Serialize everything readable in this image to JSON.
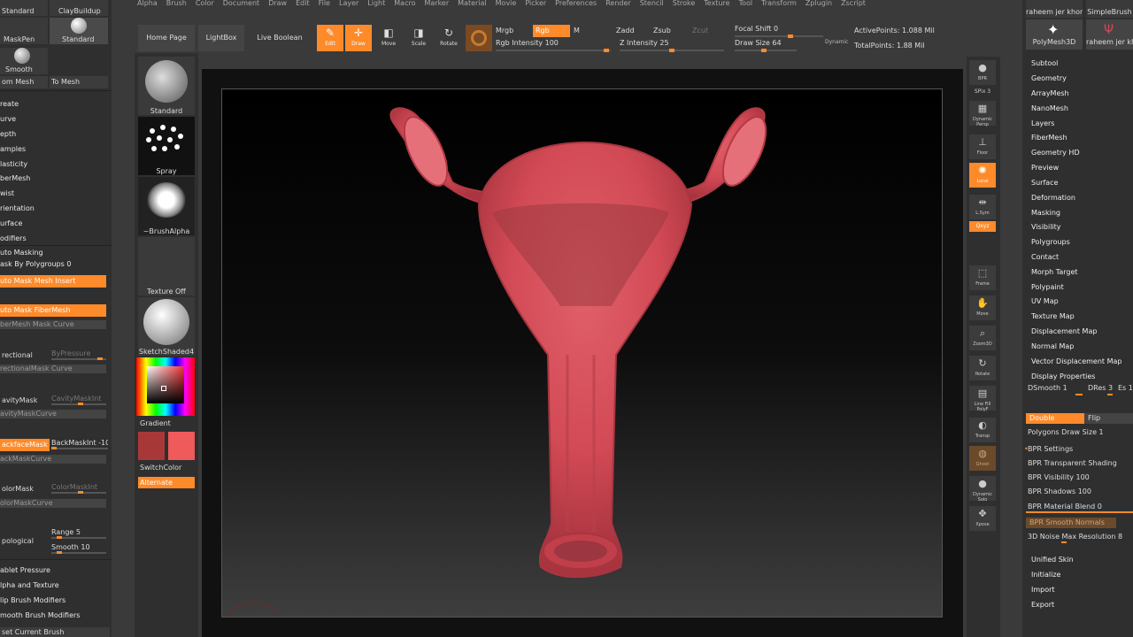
{
  "menu": [
    "Alpha",
    "Brush",
    "Color",
    "Document",
    "Draw",
    "Edit",
    "File",
    "Layer",
    "Light",
    "Macro",
    "Marker",
    "Material",
    "Movie",
    "Picker",
    "Preferences",
    "Render",
    "Stencil",
    "Stroke",
    "Texture",
    "Tool",
    "Transform",
    "Zplugin",
    "Zscript"
  ],
  "left_top": {
    "standard": "Standard",
    "claybuildup": "ClayBuildup",
    "maskpen": "MaskPen",
    "standard2": "Standard",
    "smooth": "Smooth",
    "from_mesh": "om Mesh",
    "to_mesh": "To Mesh"
  },
  "left_menu": [
    "reate",
    "urve",
    "epth",
    "amples",
    "lasticity",
    "berMesh",
    "wist",
    "rientation",
    "urface",
    "odifiers"
  ],
  "auto_masking": {
    "header": "uto Masking",
    "mask_by_polygroups": "ask By Polygroups 0",
    "auto_mask_mesh_insert": "uto Mask Mesh Insert",
    "auto_mask_fibermesh": "uto Mask FiberMesh",
    "fibermesh_mask_curve": "berMesh Mask Curve",
    "directional": "rectional",
    "by_pressure": "ByPressure",
    "directional_mask_curve": "rectionalMask Curve",
    "cavity_mask": "avityMask",
    "cavity_mask_int": "CavityMaskInt",
    "cavity_mask_curve": "avityMaskCurve",
    "backface_mask": "ackfaceMask",
    "backmask_int": "BackMaskInt -10",
    "backmask_curve": "ackMaskCurve",
    "color_mask": "olorMask",
    "color_mask_int": "ColorMaskInt",
    "color_mask_curve": "olorMaskCurve",
    "topological": "pological",
    "range": "Range 5",
    "smooth": "Smooth 10"
  },
  "left_bottom": [
    "ablet Pressure",
    "lpha and Texture",
    "lip Brush Modifiers",
    "mooth Brush Modifiers",
    "set Current Brush"
  ],
  "brushes": {
    "standard": "Standard",
    "spray": "Spray",
    "brush_alpha": "~BrushAlpha",
    "texture_off": "Texture Off",
    "material": "SketchShaded4",
    "gradient": "Gradient",
    "switch_color": "SwitchColor",
    "alternate": "Alternate",
    "color_main": "#a83838",
    "color_secondary": "#ef5a5a"
  },
  "toolbar": {
    "home_page": "Home Page",
    "lightbox": "LightBox",
    "live_boolean": "Live Boolean",
    "edit": "Edit",
    "draw": "Draw",
    "move": "Move",
    "scale": "Scale",
    "rotate": "Rotate",
    "mrgb": "Mrgb",
    "rgb": "Rgb",
    "m": "M",
    "rgb_intensity": "Rgb Intensity 100",
    "zadd": "Zadd",
    "zsub": "Zsub",
    "zcut": "Zcut",
    "z_intensity": "Z Intensity 25",
    "focal_shift": "Focal Shift 0",
    "draw_size": "Draw Size 64",
    "dynamic": "Dynamic",
    "active_points": "ActivePoints: 1.088 Mil",
    "total_points": "TotalPoints: 1.88 Mil"
  },
  "right_shelf": [
    "BPR",
    "SPix 3",
    "Dynamic Persp",
    "Floor",
    "Local",
    "L.Sym",
    "Qxyz",
    "Frame",
    "Move",
    "Zoom3D",
    "Rotate",
    "Line Fill PolyF",
    "Transp",
    "Ghost",
    "Dynamic Solo",
    "Xpose"
  ],
  "tools": {
    "tool1": "raheem jer khord",
    "tool2": "SimpleBrush",
    "tool3": "PolyMesh3D",
    "tool4": "raheem jer khord"
  },
  "subtool_menu": [
    "Subtool",
    "Geometry",
    "ArrayMesh",
    "NanoMesh",
    "Layers",
    "FiberMesh",
    "Geometry HD",
    "Preview",
    "Surface",
    "Deformation",
    "Masking",
    "Visibility",
    "Polygroups",
    "Contact",
    "Morph Target",
    "Polypaint",
    "UV Map",
    "Texture Map",
    "Displacement Map",
    "Normal Map",
    "Vector Displacement Map"
  ],
  "display_properties": {
    "header": "Display Properties",
    "dsmooth": "DSmooth 1",
    "dres": "DRes 3",
    "es": "Es 1",
    "double": "Double",
    "flip": "Flip",
    "polygons_draw_size": "Polygons Draw Size 1"
  },
  "bpr_settings": {
    "header": "BPR Settings",
    "transparent_shading": "BPR Transparent Shading",
    "visibility": "BPR Visibility 100",
    "shadows": "BPR Shadows 100",
    "material_blend": "BPR Material Blend 0",
    "smooth_normals": "BPR Smooth Normals",
    "noise_max": "3D Noise Max Resolution 8"
  },
  "right_bottom": [
    "Unified Skin",
    "Initialize",
    "Import",
    "Export"
  ]
}
